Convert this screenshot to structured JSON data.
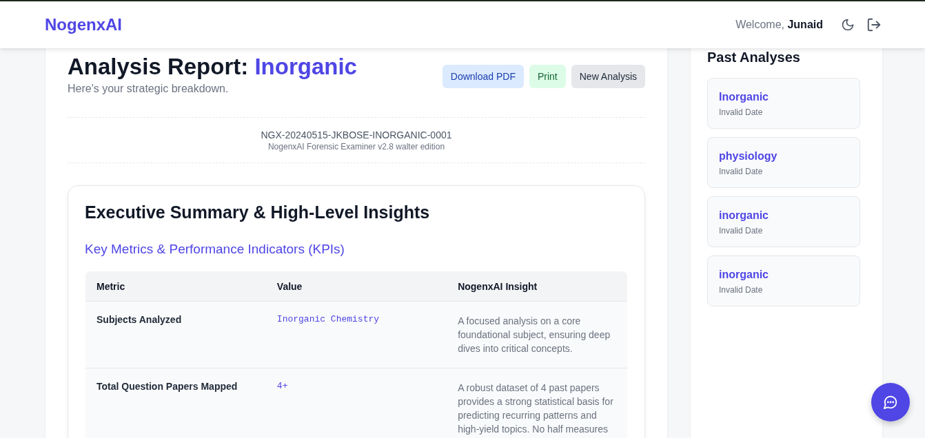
{
  "header": {
    "logo": "NogenxAI",
    "welcome": "Welcome,",
    "user": "Junaid"
  },
  "report": {
    "title": "Analysis Report:",
    "subject": "Inorganic",
    "subtitle": "Here's your strategic breakdown.",
    "buttons": [
      {
        "label": "Download PDF",
        "kind": "blue"
      },
      {
        "label": "Print",
        "kind": "green"
      },
      {
        "label": "New Analysis",
        "kind": "gray"
      }
    ],
    "report_id": "NGX-20240515-JKBOSE-INORGANIC-0001",
    "engine": "NogenxAI Forensic Examiner v2.8 walter edition"
  },
  "summary": {
    "title": "Executive Summary & High-Level Insights",
    "subtitle": "Key Metrics & Performance Indicators (KPIs)",
    "table": {
      "columns": [
        "Metric",
        "Value",
        "NogenxAI Insight"
      ],
      "rows": [
        {
          "metric": "Subjects Analyzed",
          "value": "Inorganic Chemistry",
          "insight": "A focused analysis on a core foundational subject, ensuring deep dives into critical concepts."
        },
        {
          "metric": "Total Question Papers Mapped",
          "value": "4+",
          "insight": "A robust dataset of 4 past papers provides a strong statistical basis for predicting recurring patterns and high-yield topics. No half measures"
        }
      ]
    }
  },
  "sidebar": {
    "title": "Past Analyses",
    "items": [
      {
        "name": "Inorganic",
        "date": "Invalid Date"
      },
      {
        "name": "physiology",
        "date": "Invalid Date"
      },
      {
        "name": "inorganic",
        "date": "Invalid Date"
      },
      {
        "name": "inorganic",
        "date": "Invalid Date"
      }
    ]
  }
}
